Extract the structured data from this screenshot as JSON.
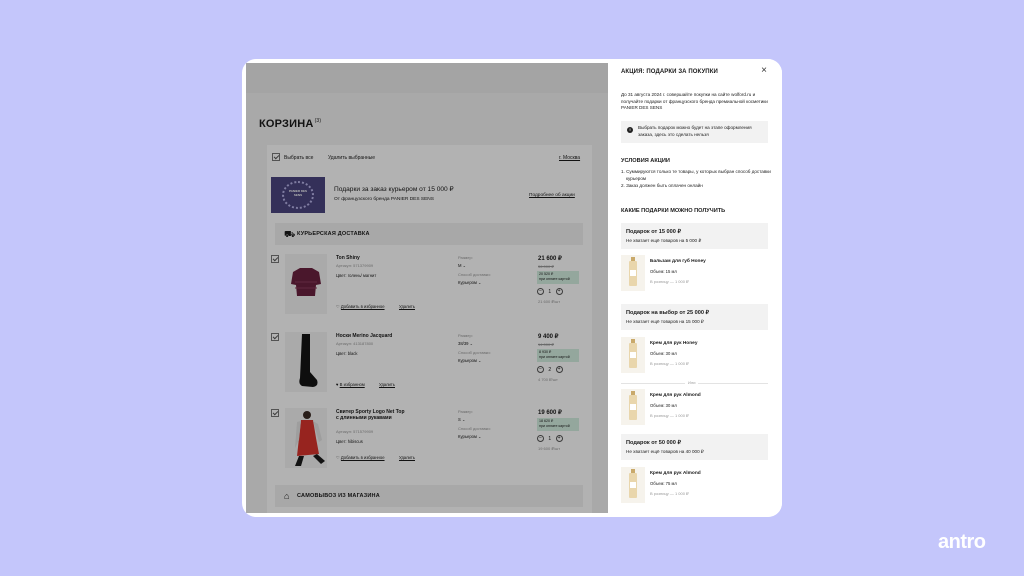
{
  "cart": {
    "title": "КОРЗИНА",
    "count": "(3)",
    "select_all": "Выбрать все",
    "delete_selected": "Удалить выбранные",
    "city": "г. Москва",
    "promo": {
      "image_text": "PANIER DES SENS",
      "title": "Подарки за заказ курьером от 15 000 ₽",
      "subtitle": "От французского бренда PANIER DES SENS",
      "link": "Подробнее об акции"
    },
    "courier_section": "КУРЬЕРСКАЯ ДОСТАВКА",
    "pickup_section": "САМОВЫВОЗ ИЗ МАГАЗИНА",
    "size_label": "Размер:",
    "delivery_label": "Способ доставки:",
    "items": [
      {
        "name": "Ton Shiny",
        "article": "Артикул: 571379909",
        "color": "Цвет: голень/ магнит",
        "size": "M",
        "delivery": "Курьером",
        "price": "21 600 ₽",
        "old_price": "36 000 ₽",
        "card_price": "20 520 ₽",
        "card_note": "при оплате картой",
        "qty": "1",
        "unit_price": "21 600 ₽/шт",
        "fav": "Добавить в избранное",
        "delete": "Удалить"
      },
      {
        "name": "Носки Merino Jacquard",
        "article": "Артикул: 413187800",
        "color": "Цвет: black",
        "size": "38/39",
        "delivery": "Курьером",
        "price": "9 400 ₽",
        "old_price": "14 000 ₽",
        "card_price": "8 930 ₽",
        "card_note": "при оплате картой",
        "qty": "2",
        "unit_price": "4 700 ₽/шт",
        "fav": "В избранном",
        "delete": "Удалить"
      },
      {
        "name": "Свитер Sporty Logo Net Top с длинными рукавами",
        "article": "Артикул: 571579909",
        "color": "Цвет: hibiscus",
        "size": "S",
        "delivery": "Курьером",
        "price": "19 600 ₽",
        "old_price": "",
        "card_price": "18 620 ₽",
        "card_note": "при оплате картой",
        "qty": "1",
        "unit_price": "19 600 ₽/шт",
        "fav": "Добавить в избранное",
        "delete": "Удалить"
      }
    ]
  },
  "modal": {
    "title": "АКЦИЯ: ПОДАРКИ ЗА ПОКУПКИ",
    "intro": "До 31 августа 2024 г. совершайте покупки на сайте wolford.ru и получайте подарки от французского бренда премиальной косметики PANIER DES SENS",
    "info": "Выбрать подарок можно будет на этапе оформления заказа, здесь это сделать нельзя",
    "conditions_title": "УСЛОВИЯ АКЦИИ",
    "conditions": [
      "1. Суммируются только те товары, у которых выбран способ доставки курьером",
      "2. Заказ должен быть оплачен онлайн"
    ],
    "gifts_title": "КАКИЕ ПОДАРКИ МОЖНО ПОЛУЧИТЬ",
    "or": "Или",
    "tiers": [
      {
        "title": "Подарок от 15 000 ₽",
        "missing": "Не хватает ещё товаров на 5 000 ₽"
      },
      {
        "title": "Подарок на выбор от 25 000 ₽",
        "missing": "Не хватает ещё товаров на 15 000 ₽"
      },
      {
        "title": "Подарок от 50 000 ₽",
        "missing": "Не хватает ещё товаров на 40 000 ₽"
      }
    ],
    "gifts": [
      {
        "name": "Бальзам для губ Honey",
        "volume": "Объем: 15 мл",
        "retail": "В розницу — 1 000 ₽"
      },
      {
        "name": "Крем для рук Honey",
        "volume": "Объем: 30 мл",
        "retail": "В розницу — 1 000 ₽"
      },
      {
        "name": "Крем для рук Almond",
        "volume": "Объем: 30 мл",
        "retail": "В розницу — 1 000 ₽"
      },
      {
        "name": "Крем для рук Almond",
        "volume": "Объем: 75 мл",
        "retail": "В розницу — 1 000 ₽"
      }
    ]
  },
  "brand": "antro"
}
